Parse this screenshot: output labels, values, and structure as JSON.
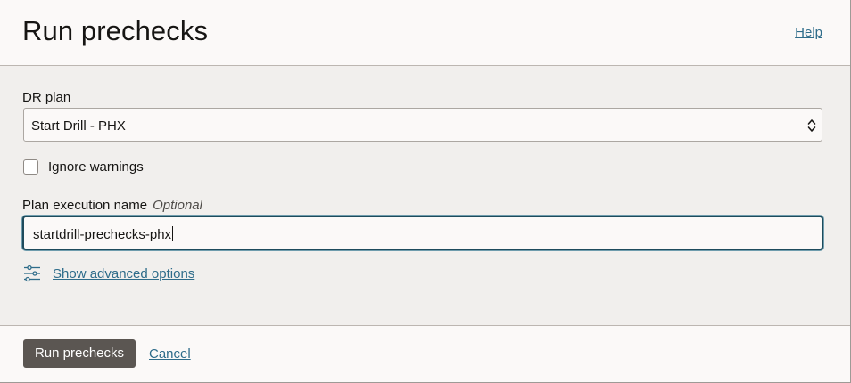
{
  "header": {
    "title": "Run prechecks",
    "help_label": "Help"
  },
  "form": {
    "dr_plan": {
      "label": "DR plan",
      "selected_value": "Start Drill - PHX"
    },
    "ignore_warnings": {
      "label": "Ignore warnings",
      "checked": false
    },
    "plan_execution_name": {
      "label": "Plan execution name",
      "optional_label": "Optional",
      "value": "startdrill-prechecks-phx"
    },
    "advanced": {
      "label": "Show advanced options",
      "icon": "sliders-icon"
    }
  },
  "footer": {
    "primary_label": "Run prechecks",
    "cancel_label": "Cancel"
  },
  "colors": {
    "link": "#2e6c8a",
    "primary_button": "#5b5652",
    "focus_border": "#1e4b5c"
  }
}
